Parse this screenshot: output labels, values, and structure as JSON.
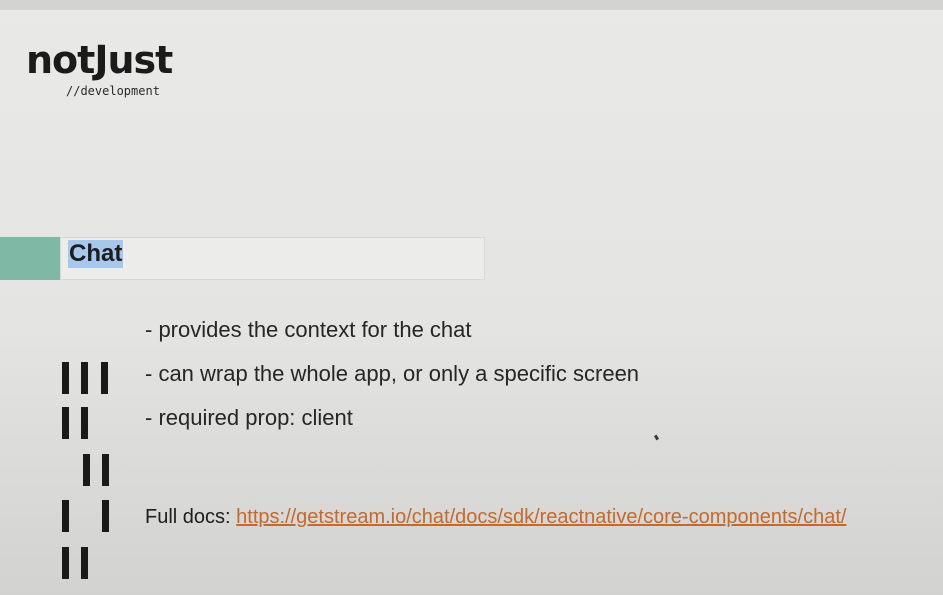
{
  "logo": {
    "name": "notJust",
    "tagline": "//development"
  },
  "section": {
    "title": "Chat"
  },
  "bullets": [
    "- provides the context for the chat",
    "- can wrap the whole app, or only a specific screen",
    "- required prop: client"
  ],
  "docs": {
    "label": "Full docs: ",
    "link_text": "https://getstream.io/chat/docs/sdk/reactnative/core-components/chat/"
  },
  "colors": {
    "accent": "#7fb9a5",
    "link": "#c46a2b",
    "selection": "#a6c8ec"
  },
  "icons": {
    "cursor": "mouse-pointer-icon"
  }
}
